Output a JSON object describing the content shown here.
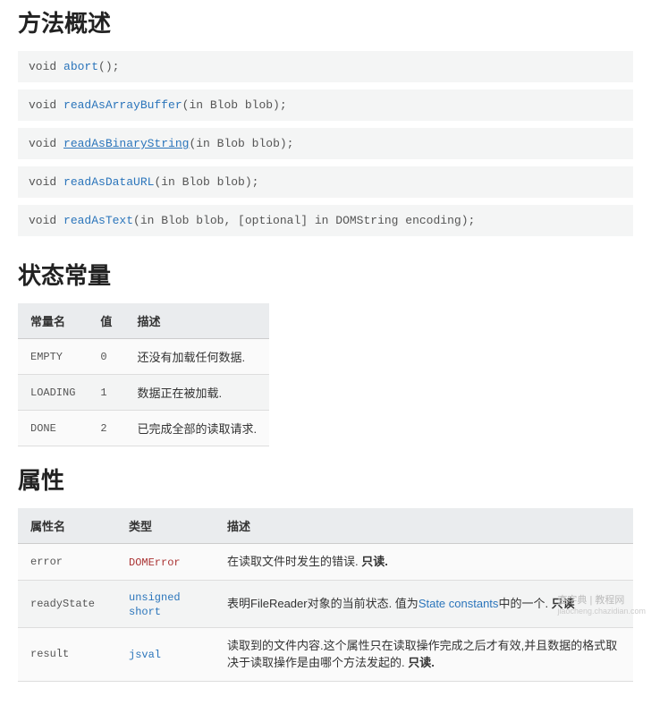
{
  "section_methods": {
    "title": "方法概述",
    "rows": [
      {
        "pre": "void ",
        "name": "abort",
        "post": "();",
        "underline": false
      },
      {
        "pre": "void ",
        "name": "readAsArrayBuffer",
        "post": "(in Blob blob);",
        "underline": false
      },
      {
        "pre": "void ",
        "name": "readAsBinaryString",
        "post": "(in Blob blob);",
        "underline": true
      },
      {
        "pre": "void ",
        "name": "readAsDataURL",
        "post": "(in Blob blob);",
        "underline": false
      },
      {
        "pre": "void ",
        "name": "readAsText",
        "post": "(in Blob blob, [optional] in DOMString encoding);",
        "underline": false
      }
    ]
  },
  "section_constants": {
    "title": "状态常量",
    "headers": {
      "name": "常量名",
      "value": "值",
      "desc": "描述"
    },
    "rows": [
      {
        "name": "EMPTY",
        "value": "0",
        "desc": "还没有加载任何数据."
      },
      {
        "name": "LOADING",
        "value": "1",
        "desc": "数据正在被加载."
      },
      {
        "name": "DONE",
        "value": "2",
        "desc": "已完成全部的读取请求."
      }
    ]
  },
  "section_props": {
    "title": "属性",
    "headers": {
      "name": "属性名",
      "type": "类型",
      "desc": "描述"
    },
    "rows": [
      {
        "name": "error",
        "type_text": "DOMError",
        "type_kind": "error",
        "desc_pre": "在读取文件时发生的错误. ",
        "desc_bold": "只读.",
        "link_text": ""
      },
      {
        "name": "readyState",
        "type_text": "unsigned short",
        "type_kind": "link",
        "desc_pre": "表明FileReader对象的当前状态. 值为",
        "link_text": "State constants",
        "desc_mid": "中的一个. ",
        "desc_bold": "只读"
      },
      {
        "name": "result",
        "type_text": "jsval",
        "type_kind": "link",
        "desc_pre": "读取到的文件内容.这个属性只在读取操作完成之后才有效,并且数据的格式取决于读取操作是由哪个方法发起的. ",
        "desc_bold": "只读.",
        "link_text": ""
      }
    ]
  },
  "watermark": {
    "main": "查字典 | 教程网",
    "sub": "jiaocheng.chazidian.com"
  }
}
